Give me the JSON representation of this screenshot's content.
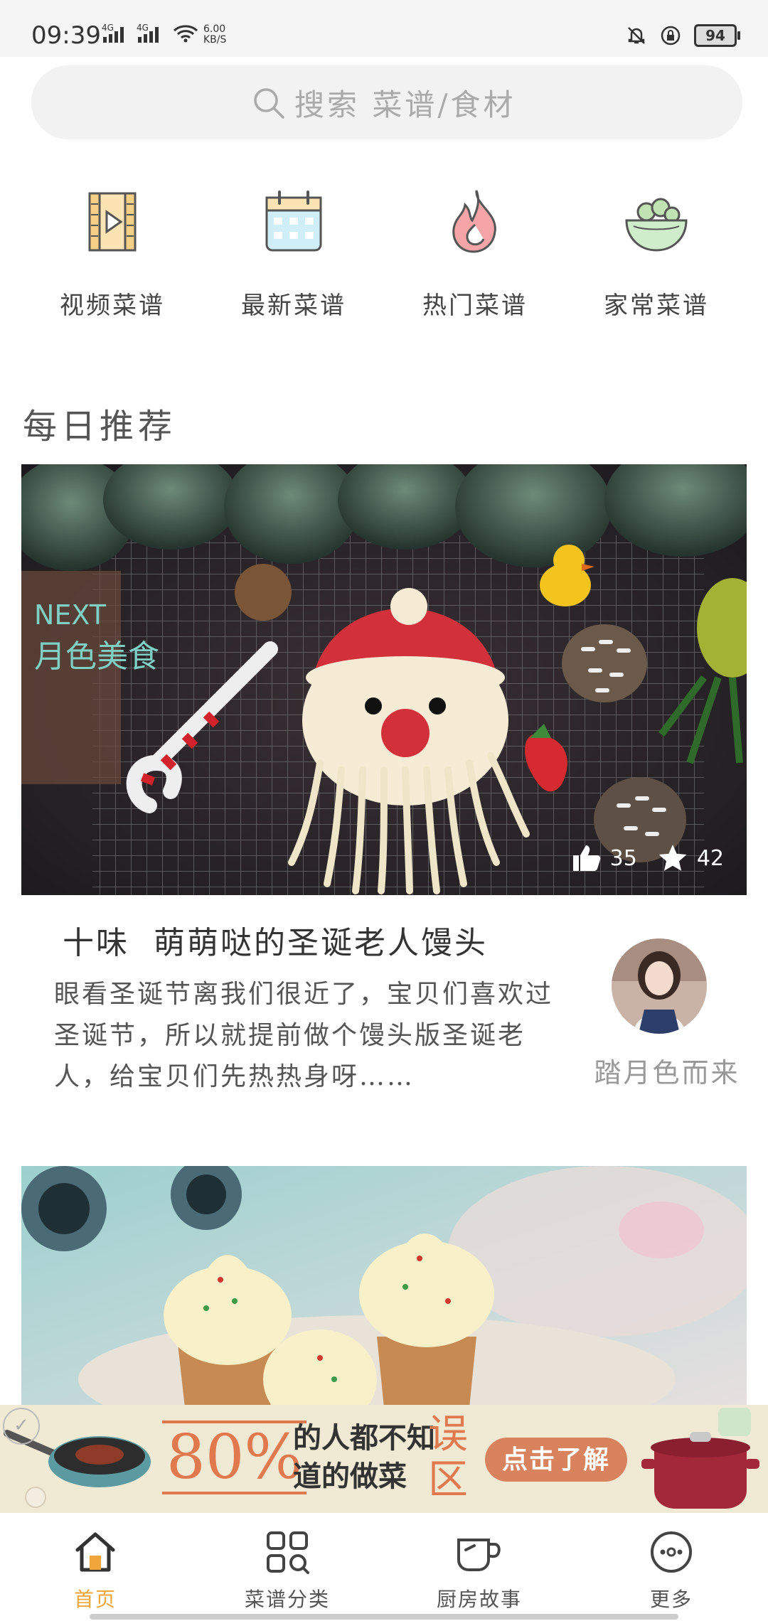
{
  "status_bar": {
    "time": "09:39",
    "signal1": "4G",
    "signal2": "4G",
    "speed_value": "6.00",
    "speed_unit": "KB/S",
    "battery": "94"
  },
  "search": {
    "placeholder": "搜索  菜谱/食材",
    "icon": "search-icon"
  },
  "quick_links": [
    {
      "label": "视频菜谱",
      "icon": "video-recipe-icon"
    },
    {
      "label": "最新菜谱",
      "icon": "calendar-icon"
    },
    {
      "label": "热门菜谱",
      "icon": "flame-icon"
    },
    {
      "label": "家常菜谱",
      "icon": "salad-bowl-icon"
    }
  ],
  "section": {
    "title": "每日推荐"
  },
  "recommend": {
    "likes": "35",
    "favorites": "42",
    "title": "十味  萌萌哒的圣诞老人馒头",
    "description": "眼看圣诞节离我们很近了，宝贝们喜欢过圣诞节，所以就提前做个馒头版圣诞老人，给宝贝们先热热身呀……",
    "author": "踏月色而来",
    "image_text": {
      "brand": "NEXT",
      "sub": "月色美食"
    }
  },
  "ad": {
    "percent": "80%",
    "line1": "的人都不知",
    "line2": "道的做菜",
    "warn": "误区",
    "button": "点击了解"
  },
  "tabbar": [
    {
      "label": "首页",
      "icon": "home-icon",
      "active": true
    },
    {
      "label": "菜谱分类",
      "icon": "category-search-icon",
      "active": false
    },
    {
      "label": "厨房故事",
      "icon": "cup-icon",
      "active": false
    },
    {
      "label": "更多",
      "icon": "more-icon",
      "active": false
    }
  ],
  "colors": {
    "accent": "#f0a63a",
    "ad_orange": "#e07a4e"
  }
}
